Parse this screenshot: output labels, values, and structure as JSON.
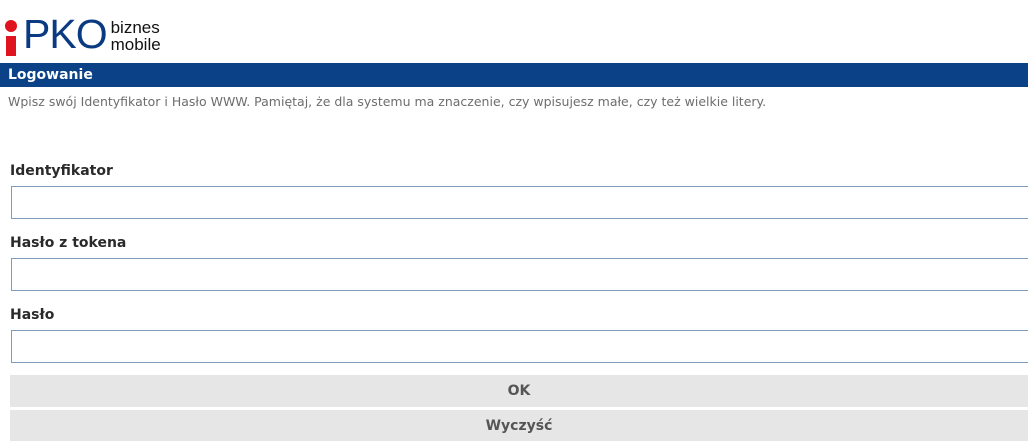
{
  "logo": {
    "brand": "PKO",
    "line1": "biznes",
    "line2": "mobile",
    "brand_color": "#0a3a82",
    "accent_color": "#e0141e"
  },
  "header": {
    "title": "Logowanie",
    "bg_color": "#0b4186"
  },
  "instruction": "Wpisz swój Identyfikator i Hasło WWW. Pamiętaj, że dla systemu ma znaczenie, czy wpisujesz małe, czy też wielkie litery.",
  "form": {
    "fields": [
      {
        "label": "Identyfikator",
        "value": ""
      },
      {
        "label": "Hasło z tokena",
        "value": ""
      },
      {
        "label": "Hasło",
        "value": ""
      }
    ],
    "ok_label": "OK",
    "clear_label": "Wyczyść"
  }
}
